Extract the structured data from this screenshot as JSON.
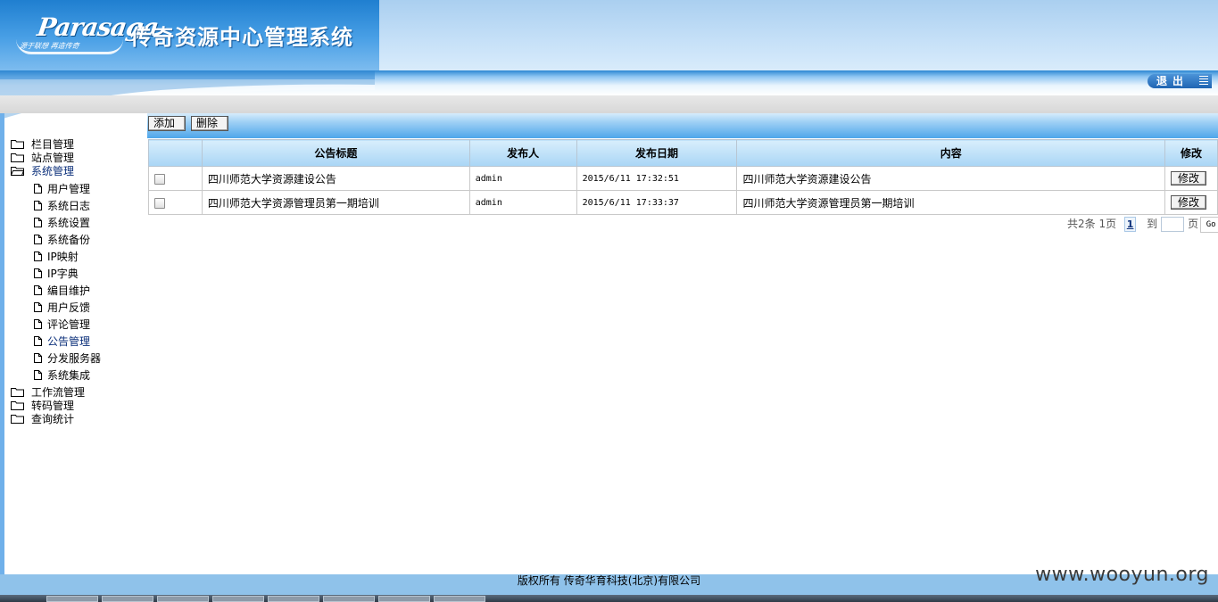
{
  "header": {
    "logo_en": "Parasaga",
    "logo_slogan": "源于联想 再造传奇",
    "system_title": "传奇资源中心管理系统",
    "logout_label": "退出"
  },
  "sidebar": {
    "groups": [
      {
        "label": "栏目管理"
      },
      {
        "label": "站点管理"
      },
      {
        "label": "系统管理",
        "active": true
      }
    ],
    "sub_items": [
      {
        "label": "用户管理"
      },
      {
        "label": "系统日志"
      },
      {
        "label": "系统设置"
      },
      {
        "label": "系统备份"
      },
      {
        "label": "IP映射"
      },
      {
        "label": "IP字典"
      },
      {
        "label": "编目维护"
      },
      {
        "label": "用户反馈"
      },
      {
        "label": "评论管理"
      },
      {
        "label": "公告管理",
        "active": true
      },
      {
        "label": "分发服务器"
      },
      {
        "label": "系统集成"
      }
    ],
    "groups_after": [
      {
        "label": "工作流管理"
      },
      {
        "label": "转码管理"
      },
      {
        "label": "查询统计"
      }
    ]
  },
  "toolbar": {
    "add_label": "添加",
    "delete_label": "删除"
  },
  "table": {
    "columns": [
      "",
      "公告标题",
      "发布人",
      "发布日期",
      "内容",
      "修改"
    ],
    "rows": [
      {
        "title": "四川师范大学资源建设公告",
        "publisher": "admin",
        "date": "2015/6/11 17:32:51",
        "content": "四川师范大学资源建设公告",
        "edit_label": "修改"
      },
      {
        "title": "四川师范大学资源管理员第一期培训",
        "publisher": "admin",
        "date": "2015/6/11 17:33:37",
        "content": "四川师范大学资源管理员第一期培训",
        "edit_label": "修改"
      }
    ]
  },
  "pager": {
    "summary": "共2条 1页",
    "current_page": "1",
    "goto_label": "到",
    "page_unit": "页",
    "go_label": "Go"
  },
  "footer": {
    "copyright": "版权所有 传奇华育科技(北京)有限公司"
  },
  "watermark": "www.wooyun.org",
  "colors": {
    "header_blue": "#1f7fd0",
    "toolbar_blue": "#4ea6ea",
    "footer_blue": "#8fc2ea",
    "active_text": "#0b2f7a"
  }
}
